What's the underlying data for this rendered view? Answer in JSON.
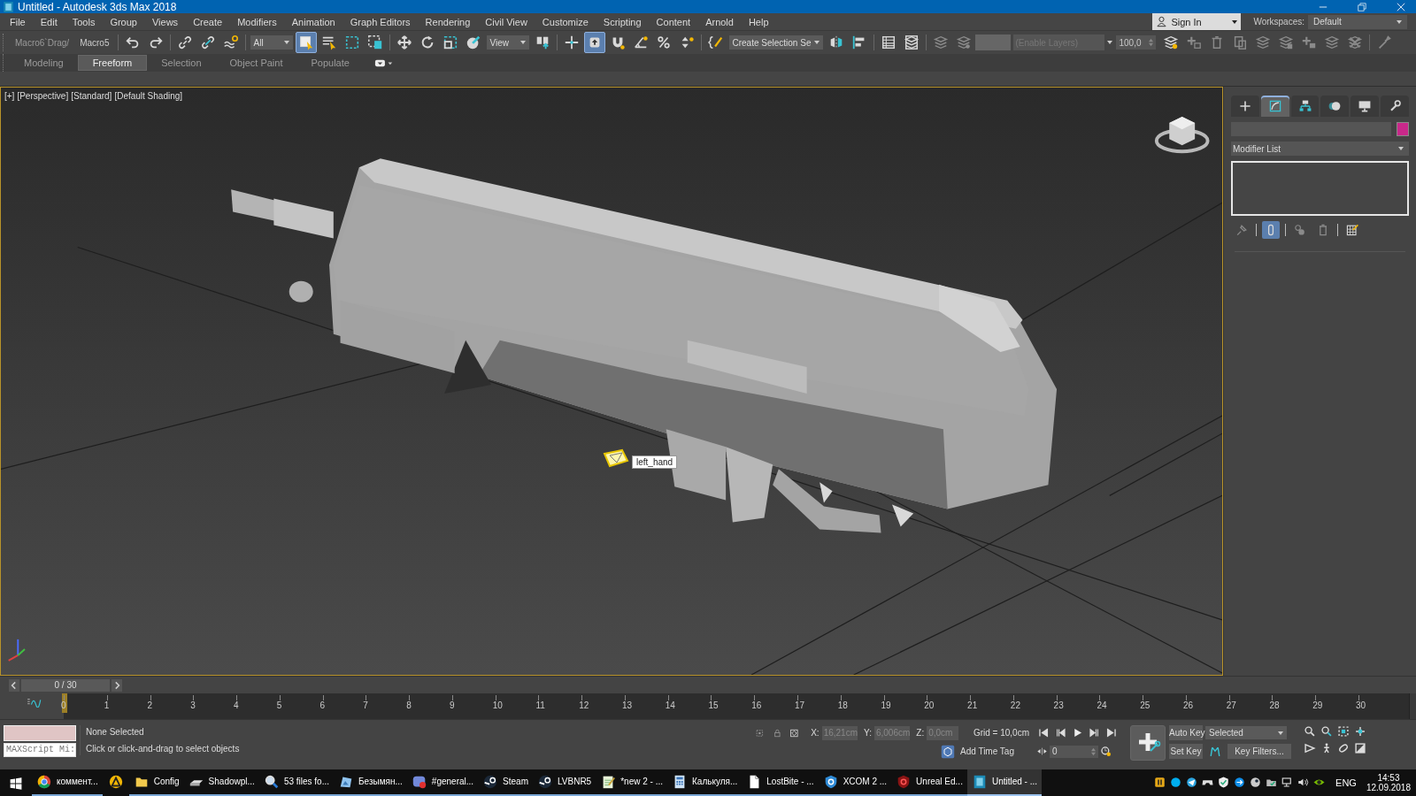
{
  "window": {
    "title": "Untitled - Autodesk 3ds Max 2018"
  },
  "menu": [
    "File",
    "Edit",
    "Tools",
    "Group",
    "Views",
    "Create",
    "Modifiers",
    "Animation",
    "Graph Editors",
    "Rendering",
    "Civil View",
    "Customize",
    "Scripting",
    "Content",
    "Arnold",
    "Help"
  ],
  "sign_in": {
    "label": "Sign In"
  },
  "workspaces": {
    "label": "Workspaces:",
    "value": "Default"
  },
  "toolbar": {
    "groups": [
      [
        {
          "kind": "macro",
          "label": "Macro6`Drag/"
        },
        {
          "kind": "macro",
          "label": "Macro5"
        }
      ],
      [
        {
          "kind": "undo",
          "selected": false
        },
        {
          "kind": "redo",
          "selected": false
        }
      ],
      [
        {
          "kind": "link",
          "selected": false
        },
        {
          "kind": "unlink",
          "selected": false
        },
        {
          "kind": "bind",
          "selected": false
        }
      ],
      [
        {
          "kind": "dropdown",
          "value": "All"
        },
        {
          "kind": "select",
          "selected": true
        },
        {
          "kind": "select_by_name",
          "selected": false
        },
        {
          "kind": "rect_region",
          "selected": false
        },
        {
          "kind": "crossing",
          "selected": false
        }
      ],
      [
        {
          "kind": "move",
          "selected": false
        },
        {
          "kind": "rotate",
          "selected": false
        },
        {
          "kind": "scale",
          "selected": false
        },
        {
          "kind": "placement",
          "selected": false
        },
        {
          "kind": "dropdown",
          "value": "View"
        },
        {
          "kind": "pivot",
          "selected": false
        }
      ],
      [
        {
          "kind": "manipulate",
          "selected": false
        },
        {
          "kind": "snap",
          "selected": true
        },
        {
          "kind": "snap3d",
          "selected": false
        },
        {
          "kind": "angle_snap",
          "selected": false
        },
        {
          "kind": "percent_snap",
          "selected": false
        },
        {
          "kind": "spinner_snap",
          "selected": false
        }
      ],
      [
        {
          "kind": "named_sets",
          "selected": false
        },
        {
          "kind": "dropdown",
          "value": "Create Selection Se"
        },
        {
          "kind": "mirror",
          "selected": false
        },
        {
          "kind": "align",
          "selected": false
        }
      ],
      [
        {
          "kind": "scene_explorer",
          "selected": false
        },
        {
          "kind": "layer_explorer",
          "selected": false
        }
      ],
      [
        {
          "kind": "layers",
          "selected": false
        },
        {
          "kind": "layer_toolbar",
          "selected": false
        },
        {
          "kind": "layer_field",
          "placeholder": "(Enable Layers)"
        },
        {
          "kind": "spinner",
          "value": "100,0"
        },
        {
          "kind": "layer_settings",
          "selected": false
        },
        {
          "kind": "create_layer",
          "selected": false
        },
        {
          "kind": "delete_layer",
          "selected": false
        },
        {
          "kind": "add_to_layer",
          "selected": false
        },
        {
          "kind": "select_layer",
          "selected": false
        },
        {
          "kind": "stack_layer",
          "selected": false
        },
        {
          "kind": "new_layer",
          "selected": false
        },
        {
          "kind": "isolate_layer",
          "selected": false
        },
        {
          "kind": "merge_layer",
          "selected": false
        }
      ],
      [
        {
          "kind": "paint_tool",
          "selected": false
        }
      ]
    ]
  },
  "ribbon_tabs": [
    {
      "label": "Modeling",
      "selected": false
    },
    {
      "label": "Freeform",
      "selected": true
    },
    {
      "label": "Selection",
      "selected": false
    },
    {
      "label": "Object Paint",
      "selected": false
    },
    {
      "label": "Populate",
      "selected": false
    }
  ],
  "viewport": {
    "labels": [
      "[+]",
      "[Perspective]",
      "[Standard]",
      "[Default Shading]"
    ],
    "object_label": "left_hand"
  },
  "command_panel": {
    "tabs": [
      {
        "kind": "create",
        "selected": false
      },
      {
        "kind": "modify",
        "selected": true
      },
      {
        "kind": "hierarchy",
        "selected": false
      },
      {
        "kind": "motion",
        "selected": false
      },
      {
        "kind": "display",
        "selected": false
      },
      {
        "kind": "utilities",
        "selected": false
      }
    ],
    "modifier_list": "Modifier List",
    "stack_tools": [
      {
        "kind": "pin",
        "selected": false
      },
      {
        "kind": "show_result",
        "selected": true
      },
      {
        "kind": "make_unique",
        "selected": false
      },
      {
        "kind": "remove",
        "selected": false
      },
      {
        "kind": "configure",
        "selected": false
      }
    ]
  },
  "time_slider": {
    "label": "0 / 30",
    "level": 0
  },
  "timeline": {
    "ticks": [
      "0",
      "1",
      "2",
      "3",
      "4",
      "5",
      "6",
      "7",
      "8",
      "9",
      "10",
      "11",
      "12",
      "13",
      "14",
      "15",
      "16",
      "17",
      "18",
      "19",
      "20",
      "21",
      "22",
      "23",
      "24",
      "25",
      "26",
      "27",
      "28",
      "29",
      "30"
    ]
  },
  "status": {
    "listener_placeholder": "MAXScript Mi:",
    "selection": "None Selected",
    "prompt": "Click or click-and-drag to select objects",
    "x_label": "X:",
    "x": "16,21cm",
    "y_label": "Y:",
    "y": "6,006cm",
    "z_label": "Z:",
    "z": "0,0cm",
    "grid": "Grid = 10,0cm",
    "add_time_tag": "Add Time Tag",
    "auto_key": "Auto Key",
    "key_mode": "Selected",
    "set_key": "Set Key",
    "key_filters": "Key Filters...",
    "frame": "0"
  },
  "taskbar": {
    "items": [
      {
        "kind": "browser",
        "label": "коммент...",
        "selected": false
      },
      {
        "kind": "triangle",
        "selected": false
      },
      {
        "kind": "folder",
        "label": "Config",
        "selected": false
      },
      {
        "kind": "drive",
        "label": "Shadowpl...",
        "selected": false
      },
      {
        "kind": "search",
        "label": "53 files fo...",
        "selected": false
      },
      {
        "kind": "image",
        "label": "Безымян...",
        "selected": false
      },
      {
        "kind": "chat",
        "label": "#general...",
        "selected": false
      },
      {
        "kind": "round",
        "label": "Steam",
        "selected": false
      },
      {
        "kind": "round",
        "label": "LVBNR5",
        "selected": false
      },
      {
        "kind": "notepad",
        "label": "*new 2 - ...",
        "selected": false
      },
      {
        "kind": "calculator",
        "label": "Калькуля...",
        "selected": false
      },
      {
        "kind": "document",
        "label": "LostBite - ...",
        "selected": false
      },
      {
        "kind": "shield",
        "label": "XCOM 2 ...",
        "selected": false
      },
      {
        "kind": "shield_red",
        "label": "Unreal Ed...",
        "selected": false
      },
      {
        "kind": "max",
        "label": "Untitled - ...",
        "selected": true
      }
    ],
    "language": "ENG",
    "time": "14:53",
    "date": "12.09.2018"
  }
}
